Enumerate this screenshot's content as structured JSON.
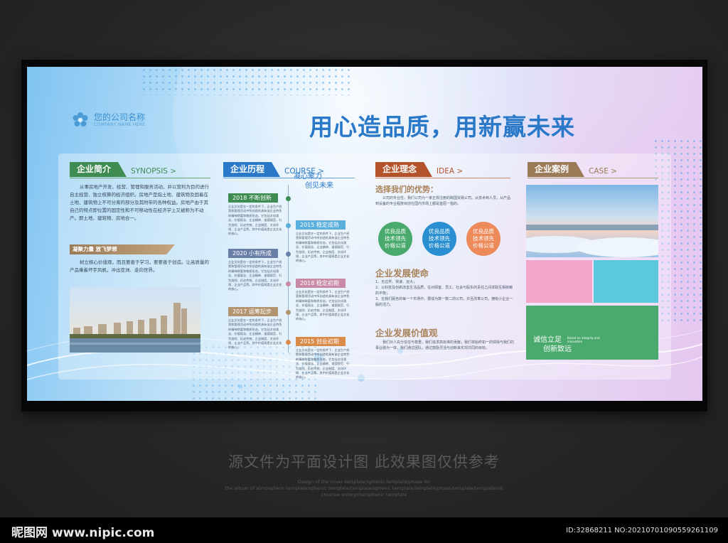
{
  "colors": {
    "blue": "#2a79c9",
    "green": "#3f8c52",
    "brown": "#9a7a57",
    "orange": "#d98b4a",
    "pink": "#f3a6c8",
    "cyan": "#5bc9dc",
    "teal": "#4aaa6d"
  },
  "company": {
    "name": "您的公司名称",
    "sub": "COMPANY NAME HERE"
  },
  "headline": "用心造品质，用新赢未来",
  "synopsis": {
    "tag": "企业简介",
    "en": "SYNOPSIS >",
    "para": "从事房地产开发、经营、管理和服务活动，并以营利为目的进行自主经营、独立核算的经济组织。房地产是指土地、建筑物及固着在土地、建筑物上不可分离的部分及其附带的各种权益。房地产由于其自己的特点即位置的固定性和不可移动性在经济学上又被称为不动产。即土地、建筑物、房地合一。",
    "sub_tag": "凝聚力量 放飞梦想",
    "para2": "树立核心价值观，而且要善于学习，要要善于创造。让高质量的产品乘着坏宇风帆，冲出亚洲、走向世界。"
  },
  "course": {
    "tag": "企业历程",
    "en": "COURSE >",
    "slogan1": "凝心聚力",
    "slogan2": "创见未来",
    "items": [
      {
        "label": "2018 不断创新",
        "text": "企业文化是在一定的条件下，企业生产经营和管理活动中所创造的具有该企业特色的精神财富和物质形态。它包括文化观念、价值观念、企业精神、道德规范、行为准则、历史传统、企业制度、文化环境、企业产品等。其中价值观是企业文化的核心。"
      },
      {
        "label": "2015 稳定成熟",
        "text": "企业文化是在一定的条件下，企业生产经营和管理活动中所创造的具有该企业特色的精神财富和物质形态。它包括文化观念、价值观念、企业精神、道德规范、行为准则、历史传统、企业制度、文化环境、企业产品等。其中价值观是企业文化的核心。"
      },
      {
        "label": "2020 小有所成",
        "text": "企业文化是在一定的条件下，企业生产经营和管理活动中所创造的具有该企业特色的精神财富和物质形态。它包括文化观念、价值观念、企业精神、道德规范、行为准则、历史传统、企业制度、文化环境、企业产品等。其中价值观是企业文化的核心。"
      },
      {
        "label": "2018 稳定初期",
        "text": "企业文化是在一定的条件下，企业生产经营和管理活动中所创造的具有该企业特色的精神财富和物质形态。它包括文化观念、价值观念、企业精神、道德规范、行为准则、历史传统、企业制度、文化环境、企业产品等。其中价值观是企业文化的核心。"
      },
      {
        "label": "2017 运筹起步",
        "text": "企业文化是在一定的条件下，企业生产经营和管理活动中所创造的具有该企业特色的精神财富和物质形态。它包括文化观念、价值观念、企业精神、道德规范、行为准则、历史传统、企业制度、文化环境、企业产品等。其中价值观是企业文化的核心。"
      },
      {
        "label": "2015 创业初期",
        "text": "企业文化是在一定的条件下，企业生产经营和管理活动中所创造的具有该企业特色的精神财富和物质形态。它包括文化观念、价值观念、企业精神、道德规范、行为准则、历史传统、企业制度、文化环境、企业产品等。其中价值观是企业文化的核心。"
      }
    ]
  },
  "idea": {
    "tag": "企业理念",
    "en": "IDEA >",
    "adv_title": "选择我们的优势：",
    "adv_text": "公司的专业性，我们公司为一家正规注册的跨国贸易公司。从技术到人员，从产品到设备的专业程度目前在国内市场上都是首屈一指的。",
    "circles": [
      {
        "l1": "优良品质",
        "l2": "技术领先",
        "l3": "价格公道"
      },
      {
        "l1": "优良品质",
        "l2": "技术领先",
        "l3": "价格公道"
      },
      {
        "l1": "优良品质",
        "l2": "技术领先",
        "l3": "价格公道"
      }
    ],
    "mission_title": "企业发展使命",
    "mission": [
      "1、无边界、快速、远大；",
      "2、以科技及创新改善生活品质，在对顾客、员工、社会与股东的责任之间求取互相依赖的平衡；",
      "3、在我们服务的每一个市场中，要成为数一数二的公司，并且改革公司，拥有小企业一般的活力。"
    ],
    "value_title": "企业发展价值观",
    "value": "我们对人充分信任与尊重，我们追求高标准的贡献，我们将始终如一的情操与我们的事业融为一体，我们通过团队，通过鼓励灵活与创新来实现共同的目标。"
  },
  "case": {
    "tag": "企业案例",
    "en": "CASE >",
    "slogan1": "诚信立足",
    "slogan2": "创新致远",
    "slogan_en": "Based on integrity and innovation"
  },
  "watermark": {
    "main": "源文件为平面设计图 此效果图仅供参考",
    "line1": "Design of the cover template/sphenic template/phase for",
    "line2": "the album of atmospheric template/sphenic template/template/sphenic template/template/phase/template/template/oil",
    "line3": "creative enterprise/sphenic template"
  },
  "footer": {
    "site": "昵图网 www.nipic.com",
    "id": "ID:32868211 NO:20210701090559261109"
  }
}
